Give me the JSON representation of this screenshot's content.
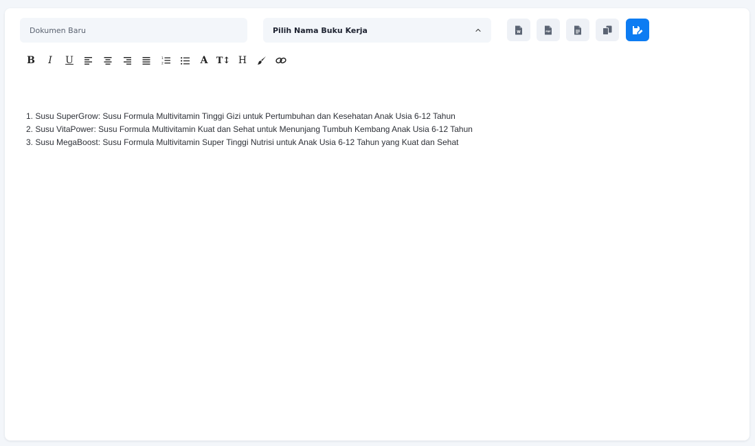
{
  "header": {
    "document_name_placeholder": "Dokumen Baru",
    "workbook_select": {
      "label": "Pilih Nama Buku Kerja",
      "icon": "chevron-up-icon"
    },
    "actions": [
      {
        "name": "export-word",
        "icon": "file-word-icon",
        "badge": "W"
      },
      {
        "name": "export-pdf",
        "icon": "file-pdf-icon",
        "badge": "PDF"
      },
      {
        "name": "export-text",
        "icon": "file-text-icon"
      },
      {
        "name": "copy",
        "icon": "copy-icon"
      },
      {
        "name": "save",
        "icon": "save-edit-icon",
        "primary": true
      }
    ]
  },
  "toolbar": {
    "tools": [
      {
        "name": "bold",
        "glyph": "B"
      },
      {
        "name": "italic",
        "glyph": "I"
      },
      {
        "name": "underline",
        "glyph": "U"
      },
      {
        "name": "align-left",
        "icon": "align-left-icon"
      },
      {
        "name": "align-center",
        "icon": "align-center-icon"
      },
      {
        "name": "align-right",
        "icon": "align-right-icon"
      },
      {
        "name": "align-justify",
        "icon": "align-justify-icon"
      },
      {
        "name": "ordered-list",
        "icon": "ordered-list-icon"
      },
      {
        "name": "unordered-list",
        "icon": "unordered-list-icon"
      },
      {
        "name": "font-color",
        "glyph": "A"
      },
      {
        "name": "font-size",
        "glyph": "T↕"
      },
      {
        "name": "heading",
        "glyph": "H"
      },
      {
        "name": "highlight",
        "icon": "brush-icon"
      },
      {
        "name": "link",
        "icon": "link-icon"
      }
    ]
  },
  "editor": {
    "items": [
      "1. Susu SuperGrow: Susu Formula Multivitamin Tinggi Gizi untuk Pertumbuhan dan Kesehatan Anak Usia 6-12 Tahun",
      "2. Susu VitaPower: Susu Formula Multivitamin Kuat dan Sehat untuk Menunjang Tumbuh Kembang Anak Usia 6-12 Tahun",
      "3. Susu MegaBoost: Susu Formula Multivitamin Super Tinggi Nutrisi untuk Anak Usia 6-12 Tahun yang Kuat dan Sehat"
    ]
  },
  "colors": {
    "primary": "#0d7cf2",
    "field_background": "#f3f6fa",
    "icon": "#5b6473"
  }
}
